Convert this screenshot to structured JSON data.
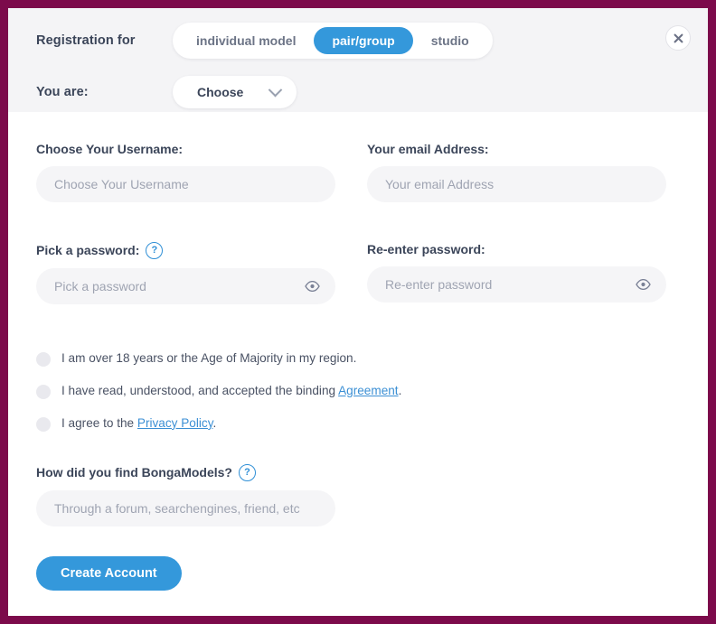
{
  "header": {
    "registration_label": "Registration for",
    "tabs": [
      {
        "label": "individual model",
        "active": false
      },
      {
        "label": "pair/group",
        "active": true
      },
      {
        "label": "studio",
        "active": false
      }
    ],
    "you_are_label": "You are:",
    "you_are_value": "Choose",
    "close_icon": "close-icon",
    "chevron_icon": "chevron-down-icon"
  },
  "fields": {
    "username": {
      "label": "Choose Your Username:",
      "placeholder": "Choose Your Username",
      "value": ""
    },
    "email": {
      "label": "Your email Address:",
      "placeholder": "Your email Address",
      "value": ""
    },
    "password": {
      "label": "Pick a password:",
      "placeholder": "Pick a password",
      "value": "",
      "help": "?",
      "eye_icon": "eye-icon"
    },
    "password_confirm": {
      "label": "Re-enter password:",
      "placeholder": "Re-enter password",
      "value": "",
      "eye_icon": "eye-icon"
    },
    "referral": {
      "label": "How did you find BongaModels?",
      "placeholder": "Through a forum, searchengines, friend, etc",
      "value": "",
      "help": "?"
    }
  },
  "consents": [
    {
      "pre": "I am over 18 years or the Age of Majority in my region.",
      "link": "",
      "post": ""
    },
    {
      "pre": "I have read, understood, and accepted the binding ",
      "link": "Agreement",
      "post": "."
    },
    {
      "pre": "I agree to the ",
      "link": "Privacy Policy",
      "post": "."
    }
  ],
  "submit": {
    "label": "Create Account"
  },
  "colors": {
    "accent": "#3498db",
    "link": "#3b8fd4",
    "frame": "#7c0a4b",
    "header_bg": "#f4f4f6",
    "input_bg": "#f5f5f7",
    "label_text": "#3b4559"
  }
}
